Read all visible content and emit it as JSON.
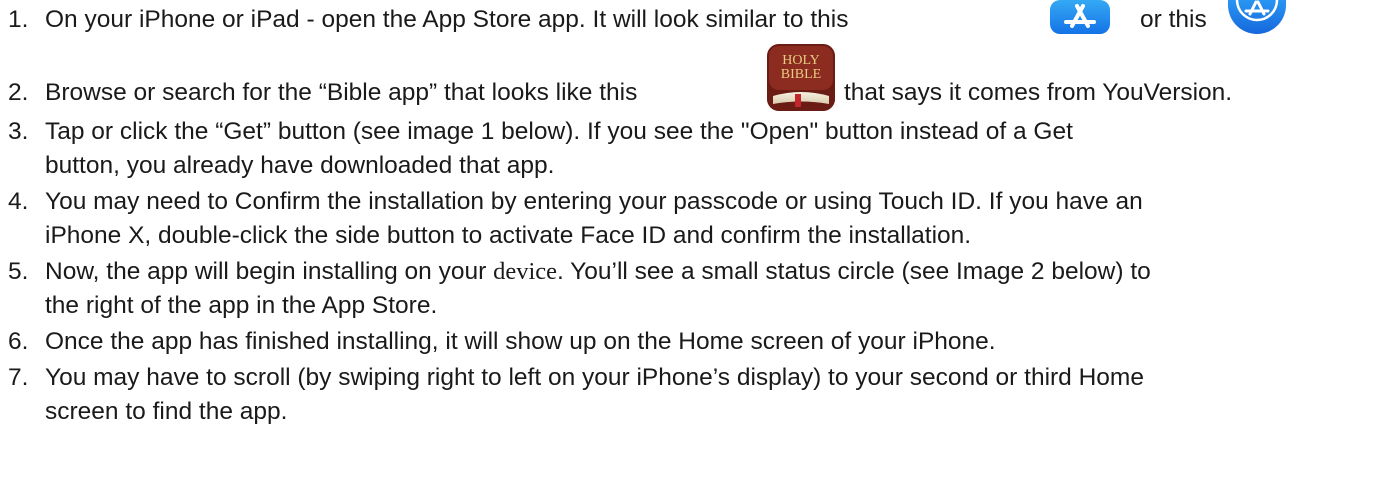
{
  "steps": [
    {
      "number": "1.",
      "before": "On your iPhone or iPad - open the App Store app. It will look similar to this",
      "between": "or this",
      "icons": [
        "app-store-icon",
        "app-store-round-icon"
      ]
    },
    {
      "number": "2.",
      "before": "Browse or search for the “Bible app” that looks like this",
      "after": "that says it comes from YouVersion.",
      "icon": "bible-app-icon",
      "icon_text": "HOLY BIBLE"
    },
    {
      "number": "3.",
      "lines": [
        "Tap or click the “Get” button (see image 1 below). If you see the \"Open\" button instead of a Get",
        "button, you already have downloaded that app."
      ]
    },
    {
      "number": "4.",
      "lines": [
        "You may need to Confirm the installation by entering your passcode or using Touch ID. If you have an",
        "iPhone X, double-click the side button to activate Face ID and confirm the installation."
      ]
    },
    {
      "number": "5.",
      "line1_before": "Now, the app will begin installing on your ",
      "line1_device": "device",
      "line1_after": ". You’ll see a small status circle (see Image 2 below) to",
      "line2": "the right of the app in the App Store."
    },
    {
      "number": "6.",
      "lines": [
        "Once the app has finished installing, it will show up on the Home screen of your iPhone."
      ]
    },
    {
      "number": "7.",
      "lines": [
        "You may have to scroll (by swiping right to left on your iPhone’s display) to your second or third Home",
        "screen to find the app."
      ]
    }
  ],
  "colors": {
    "text": "#1a1a1a",
    "app_store_blue": "#1b87ee",
    "bible_red": "#7a2318",
    "bible_gold": "#e6c879"
  }
}
